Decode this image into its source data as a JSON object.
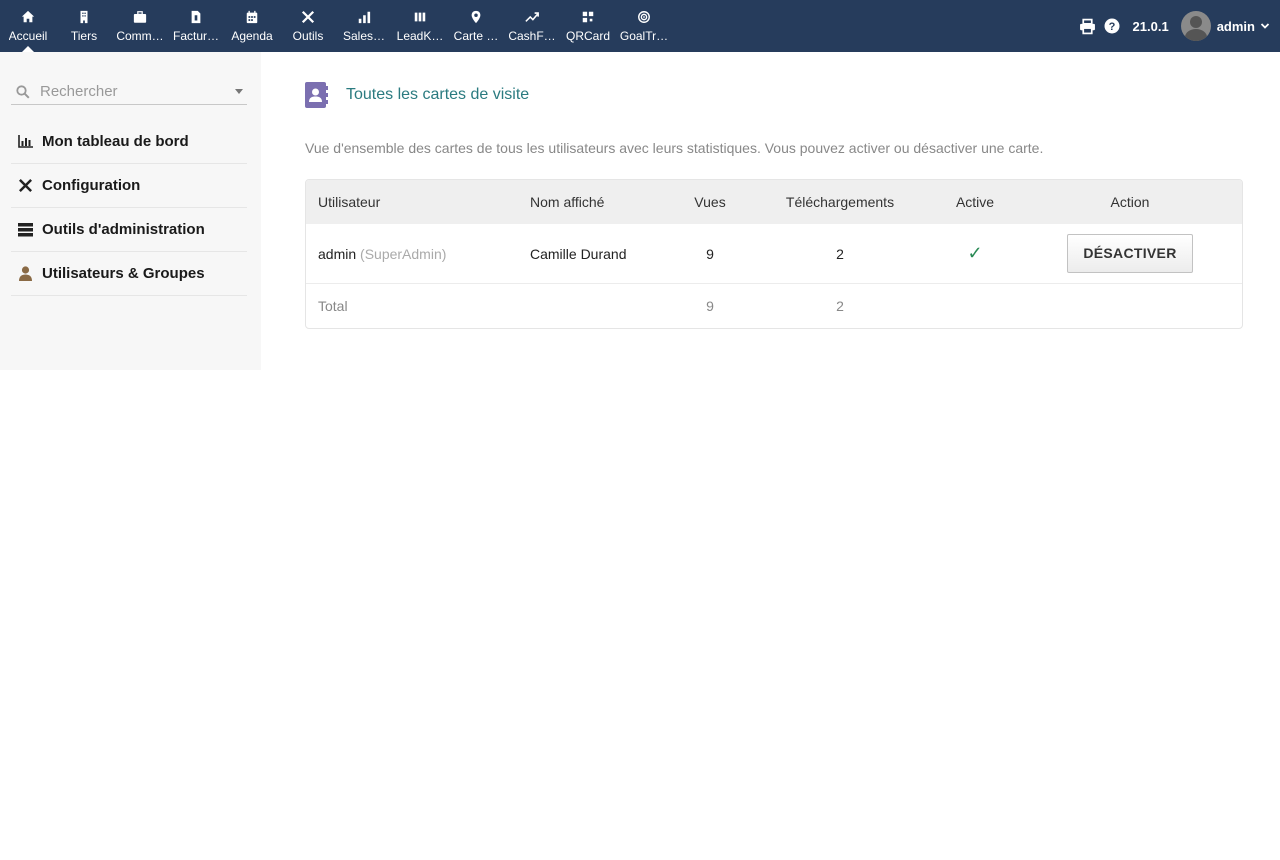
{
  "topnav": {
    "items": [
      {
        "label": "Accueil",
        "icon": "home-icon",
        "active": true
      },
      {
        "label": "Tiers",
        "icon": "building-icon"
      },
      {
        "label": "Comm…",
        "icon": "briefcase-icon"
      },
      {
        "label": "Factur…",
        "icon": "invoice-icon"
      },
      {
        "label": "Agenda",
        "icon": "calendar-icon"
      },
      {
        "label": "Outils",
        "icon": "tools-icon"
      },
      {
        "label": "Sales…",
        "icon": "bar-chart-icon"
      },
      {
        "label": "LeadK…",
        "icon": "columns-icon"
      },
      {
        "label": "Carte …",
        "icon": "map-pin-icon"
      },
      {
        "label": "CashF…",
        "icon": "trend-icon"
      },
      {
        "label": "QRCard",
        "icon": "qrcode-icon"
      },
      {
        "label": "GoalTr…",
        "icon": "target-icon"
      }
    ],
    "version": "21.0.1",
    "user": "admin"
  },
  "sidebar": {
    "search_placeholder": "Rechercher",
    "items": [
      {
        "label": "Mon tableau de bord",
        "icon": "dashboard-chart-icon"
      },
      {
        "label": "Configuration",
        "icon": "tools-icon"
      },
      {
        "label": "Outils d'administration",
        "icon": "server-icon"
      },
      {
        "label": "Utilisateurs & Groupes",
        "icon": "user-icon"
      }
    ]
  },
  "main": {
    "title": "Toutes les cartes de visite",
    "description": "Vue d'ensemble des cartes de tous les utilisateurs avec leurs statistiques. Vous pouvez activer ou désactiver une carte.",
    "table": {
      "headers": [
        "Utilisateur",
        "Nom affiché",
        "Vues",
        "Téléchargements",
        "Active",
        "Action"
      ],
      "rows": [
        {
          "user": "admin",
          "role": "(SuperAdmin)",
          "display_name": "Camille Durand",
          "views": "9",
          "downloads": "2",
          "active": "✓",
          "action": "DÉSACTIVER"
        }
      ],
      "total": {
        "label": "Total",
        "views": "9",
        "downloads": "2"
      }
    }
  },
  "colors": {
    "topbar": "#263c5c",
    "accent": "#2b7b80",
    "icon_purple": "#7b6fb0",
    "check": "#2a8a55"
  }
}
